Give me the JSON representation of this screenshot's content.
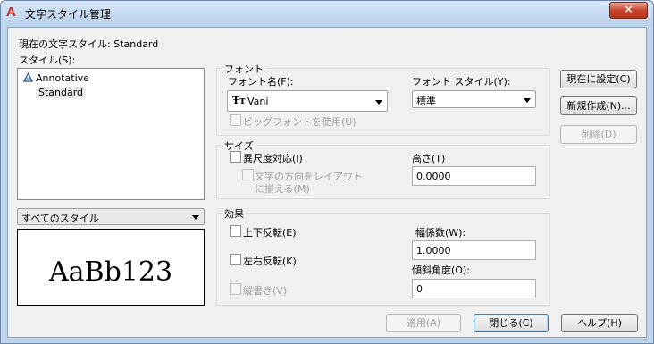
{
  "window": {
    "title": "文字スタイル管理",
    "close_label": "✕",
    "app_icon": "A"
  },
  "current_style": {
    "label": "現在の文字スタイル: Standard"
  },
  "styles": {
    "label": "スタイル(S):",
    "items": [
      {
        "label": "Annotative",
        "icon": "annotative-icon"
      },
      {
        "label": "Standard"
      }
    ],
    "filter_value": "すべてのスタイル",
    "preview_text": "AaBb123"
  },
  "font": {
    "group_title": "フォント",
    "name_label": "フォント名(F):",
    "name_value": "Vani",
    "name_icon": "truetype-icon",
    "style_label": "フォント スタイル(Y):",
    "style_value": "標準",
    "bigfont_label": "ビッグフォントを使用(U)"
  },
  "size": {
    "group_title": "サイズ",
    "annotative_label": "異尺度対応(I)",
    "match_orientation_label_1": "文字の方向をレイアウト",
    "match_orientation_label_2": "に揃える(M)",
    "height_label": "高さ(T)",
    "height_value": "0.0000"
  },
  "effects": {
    "group_title": "効果",
    "upside_down_label": "上下反転(E)",
    "backwards_label": "左右反転(K)",
    "vertical_label": "縦書き(V)",
    "width_factor_label": "幅係数(W):",
    "width_factor_value": "1.0000",
    "oblique_label": "傾斜角度(O):",
    "oblique_value": "0"
  },
  "buttons": {
    "set_current": "現在に設定(C)",
    "new": "新規作成(N)...",
    "delete": "削除(D)",
    "apply": "適用(A)",
    "close": "閉じる(C)",
    "help": "ヘルプ(H)"
  }
}
